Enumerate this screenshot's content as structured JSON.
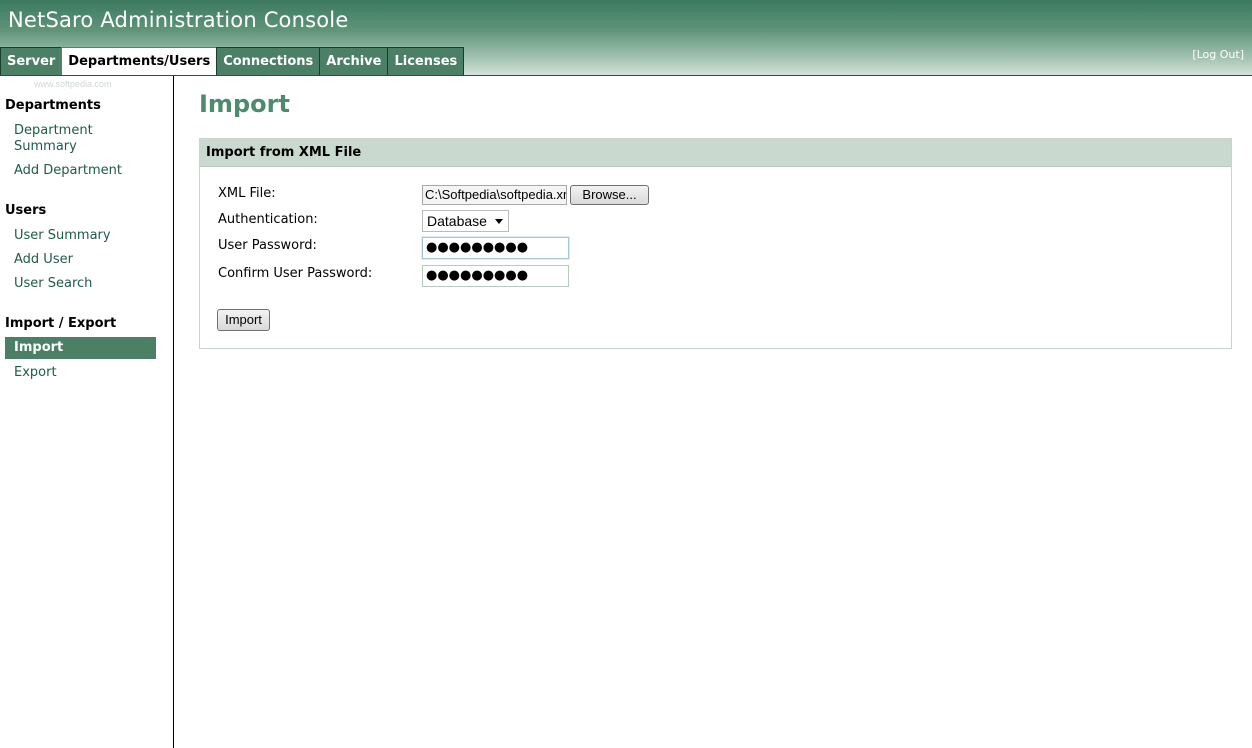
{
  "header": {
    "app_title": "NetSaro Administration Console",
    "logout_label": "[Log Out]",
    "watermark": "SOFTPEDIA",
    "watermark_url": "www.softpedia.com"
  },
  "tabs": [
    {
      "label": "Server",
      "active": false
    },
    {
      "label": "Departments/Users",
      "active": true
    },
    {
      "label": "Connections",
      "active": false
    },
    {
      "label": "Archive",
      "active": false
    },
    {
      "label": "Licenses",
      "active": false
    }
  ],
  "sidebar": {
    "departments": {
      "title": "Departments",
      "items": [
        "Department Summary",
        "Add Department"
      ]
    },
    "users": {
      "title": "Users",
      "items": [
        "User Summary",
        "Add User",
        "User Search"
      ]
    },
    "import_export": {
      "title": "Import / Export",
      "items": [
        "Import",
        "Export"
      ],
      "active": "Import"
    }
  },
  "main": {
    "page_title": "Import",
    "panel_title": "Import from XML File",
    "form": {
      "xml_file_label": "XML File:",
      "xml_file_value": "C:\\Softpedia\\softpedia.xml",
      "browse_label": "Browse...",
      "auth_label": "Authentication:",
      "auth_value": "Database",
      "user_password_label": "User Password:",
      "user_password_value": "●●●●●●●●●",
      "confirm_password_label": "Confirm User Password:",
      "confirm_password_value": "●●●●●●●●●",
      "import_button": "Import"
    }
  },
  "colors": {
    "accent_green": "#4b7f66",
    "title_green": "#4e8a6c",
    "panel_header_bg": "#c9d9cf"
  }
}
